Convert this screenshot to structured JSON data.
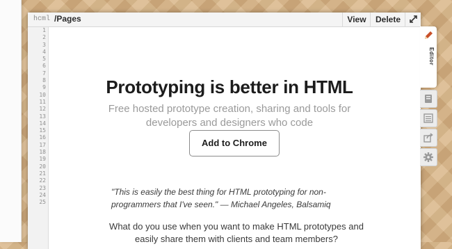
{
  "app": {
    "brand": "hcml",
    "path": "/Pages"
  },
  "toolbar": {
    "view_label": "View",
    "delete_label": "Delete"
  },
  "gutter": {
    "line_numbers": [
      "1",
      "2",
      "3",
      "4",
      "5",
      "6",
      "7",
      "8",
      "9",
      "10",
      "11",
      "12",
      "13",
      "14",
      "15",
      "16",
      "17",
      "18",
      "19",
      "20",
      "21",
      "22",
      "23",
      "24",
      "25"
    ]
  },
  "page": {
    "headline": "Prototyping is better in HTML",
    "subhead": "Free hosted prototype creation, sharing and tools for developers and designers who code",
    "cta_label": "Add to Chrome",
    "quote": "\"This is easily the best thing for HTML prototyping for non-programmers that I've seen.\" — Michael Angeles, Balsamiq",
    "question": "What do you use when you want to make HTML prototypes and easily share them with clients and team members?"
  },
  "side_tabs": {
    "editor_label": "Editor",
    "icons": [
      "pencil-icon",
      "book-icon",
      "list-icon",
      "share-icon",
      "gear-icon"
    ]
  }
}
